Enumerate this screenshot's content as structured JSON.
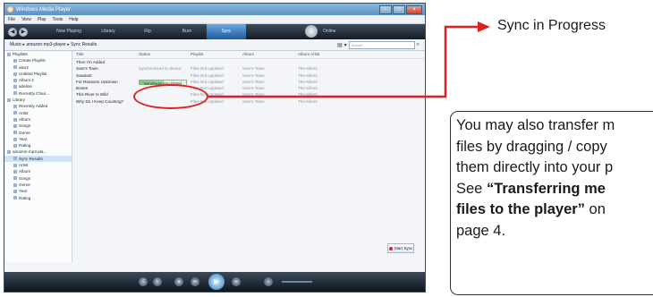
{
  "window": {
    "title": "Windows Media Player",
    "menu": [
      "File",
      "View",
      "Play",
      "Tools",
      "Help"
    ],
    "tabs": [
      "Now Playing",
      "Library",
      "Rip",
      "Burn",
      "Sync",
      "Online"
    ],
    "active_tab": "Sync",
    "breadcrumb": "Music ▸ amazon-mp3-player ▸ Sync Results",
    "search_placeholder": "Search"
  },
  "nav_pane": [
    {
      "label": "Playlists",
      "indent": 0
    },
    {
      "label": "Create Playlist",
      "indent": 1
    },
    {
      "label": "alex2",
      "indent": 1
    },
    {
      "label": "Untitled Playlist",
      "indent": 1
    },
    {
      "label": "Album 2",
      "indent": 1
    },
    {
      "label": "adeline",
      "indent": 1
    },
    {
      "label": "Recently Chan...",
      "indent": 1
    },
    {
      "label": "Library",
      "indent": 0
    },
    {
      "label": "Recently Added",
      "indent": 1
    },
    {
      "label": "Artist",
      "indent": 1
    },
    {
      "label": "Album",
      "indent": 1
    },
    {
      "label": "Songs",
      "indent": 1
    },
    {
      "label": "Genre",
      "indent": 1
    },
    {
      "label": "Year",
      "indent": 1
    },
    {
      "label": "Rating",
      "indent": 1
    },
    {
      "label": "amazon-mp3-pla...",
      "indent": 0
    },
    {
      "label": "Sync Results",
      "indent": 1,
      "selected": true
    },
    {
      "label": "Artist",
      "indent": 1
    },
    {
      "label": "Album",
      "indent": 1
    },
    {
      "label": "Songs",
      "indent": 1
    },
    {
      "label": "Genre",
      "indent": 1
    },
    {
      "label": "Year",
      "indent": 1
    },
    {
      "label": "Rating",
      "indent": 1
    }
  ],
  "list": {
    "columns": [
      "Title",
      "Status",
      "Playlist",
      "Album",
      "Album Artist"
    ],
    "rows": [
      {
        "title": "Then I'm Added",
        "status": "",
        "playlist": "",
        "album": "",
        "artist": ""
      },
      {
        "title": "Sam's Town",
        "status": "Synchronized to device",
        "playlist": "Files Not Updated",
        "album": "Sam's Town",
        "artist": "The Killers"
      },
      {
        "title": "Sawdust",
        "status": "",
        "playlist": "Files Not Updated",
        "album": "Sam's Town",
        "artist": "The Killers"
      },
      {
        "title": "For Reasons Unknown",
        "status": "Synchronizing (52%)",
        "playlist": "Files Not Updated",
        "album": "Sam's Town",
        "artist": "The Killers",
        "progress": 0.52
      },
      {
        "title": "Bones",
        "status": "",
        "playlist": "Files Not Updated",
        "album": "Sam's Town",
        "artist": "The Killers"
      },
      {
        "title": "This River Is Wild",
        "status": "",
        "playlist": "Files Not Updated",
        "album": "Sam's Town",
        "artist": "The Killers"
      },
      {
        "title": "Why Do I Keep Counting?",
        "status": "",
        "playlist": "Files Not Updated",
        "album": "Sam's Town",
        "artist": "The Killers"
      }
    ]
  },
  "start_sync_label": "Start Sync",
  "callout": {
    "label": "Sync in Progress"
  },
  "info": {
    "line1": "You may also transfer m",
    "line2": "files by dragging / copy",
    "line3": "them directly into your p",
    "line4_pre": "See ",
    "line4_bold": "“Transferring me",
    "line5_bold": "files to the player”",
    "line5_post": " on",
    "line6": "page 4."
  },
  "colors": {
    "highlight": "#e02020",
    "sync_bar": "#7fc37f",
    "nav_dark": "#141c25"
  }
}
